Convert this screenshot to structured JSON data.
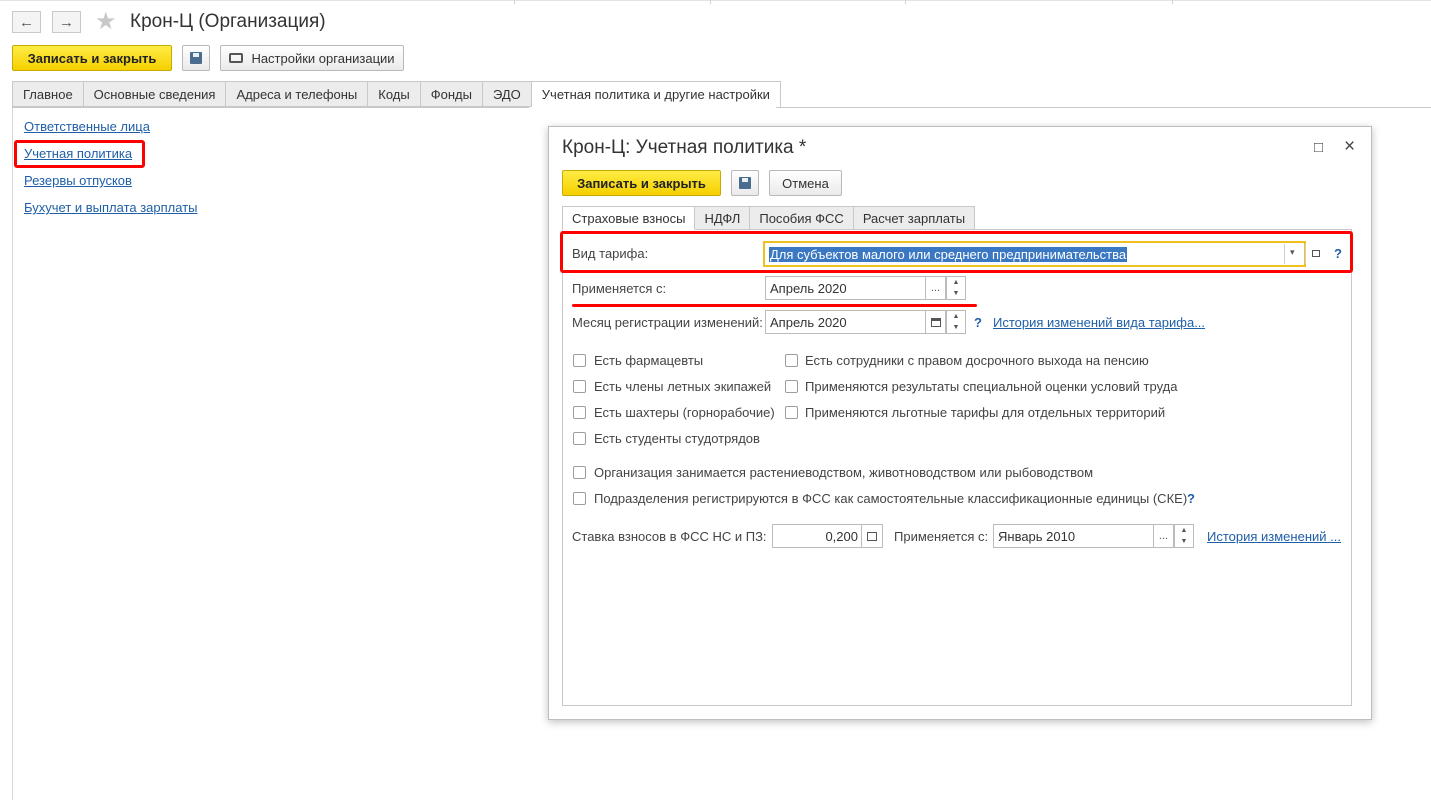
{
  "window": {
    "title": "Крон-Ц (Организация)",
    "back_icon": "←",
    "forward_icon": "→",
    "star_icon": "★"
  },
  "toolbar": {
    "save_close_label": "Записать и закрыть",
    "org_settings_label": "Настройки организации"
  },
  "tabs": [
    {
      "label": "Главное"
    },
    {
      "label": "Основные сведения"
    },
    {
      "label": "Адреса и телефоны"
    },
    {
      "label": "Коды"
    },
    {
      "label": "Фонды"
    },
    {
      "label": "ЭДО"
    },
    {
      "label": "Учетная политика и другие настройки",
      "active": true
    }
  ],
  "sidebar": {
    "links": [
      {
        "label": "Ответственные лица"
      },
      {
        "label": "Учетная политика",
        "highlighted": true
      },
      {
        "label": "Резервы отпусков"
      },
      {
        "label": "Бухучет и выплата зарплаты"
      }
    ]
  },
  "dialog": {
    "title": "Крон-Ц: Учетная политика *",
    "maximize_icon": "□",
    "close_icon": "×",
    "save_close_label": "Записать и закрыть",
    "cancel_label": "Отмена",
    "tabs": [
      {
        "label": "Страховые взносы",
        "active": true
      },
      {
        "label": "НДФЛ"
      },
      {
        "label": "Пособия ФСС"
      },
      {
        "label": "Расчет зарплаты"
      }
    ],
    "tariff": {
      "label": "Вид тарифа:",
      "value": "Для субъектов малого или среднего предпринимательства",
      "help": "?"
    },
    "applies_from": {
      "label": "Применяется с:",
      "value": "Апрель 2020",
      "dots": "..."
    },
    "reg_month": {
      "label": "Месяц регистрации изменений:",
      "value": "Апрель 2020",
      "help": "?",
      "history_link": "История изменений вида тарифа..."
    },
    "checkboxes_left": [
      {
        "label": "Есть фармацевты",
        "checked": false
      },
      {
        "label": "Есть члены летных экипажей",
        "checked": false
      },
      {
        "label": "Есть шахтеры (горнорабочие)",
        "checked": false
      },
      {
        "label": "Есть студенты студотрядов",
        "checked": false
      }
    ],
    "checkboxes_right": [
      {
        "label": "Есть сотрудники с правом досрочного выхода на пенсию",
        "checked": false
      },
      {
        "label": "Применяются результаты специальной оценки условий труда",
        "checked": false
      },
      {
        "label": "Применяются льготные тарифы для отдельных территорий",
        "checked": false
      }
    ],
    "checkboxes_bottom": [
      {
        "label": "Организация занимается растениеводством, животноводством или рыбоводством",
        "checked": false
      },
      {
        "label": "Подразделения регистрируются в ФСС как самостоятельные классификационные единицы (СКЕ)",
        "checked": false
      }
    ],
    "cke_help": "?",
    "fss": {
      "rate_label": "Ставка взносов в ФСС НС и ПЗ:",
      "rate_value": "0,200",
      "applies_label": "Применяется с:",
      "applies_value": "Январь 2010",
      "dots": "...",
      "history_link": "История изменений ..."
    }
  },
  "annotations": {
    "highlight_color": "#ff0000",
    "accent_yellow": "#f5d000",
    "link_color": "#1f5fa8"
  }
}
